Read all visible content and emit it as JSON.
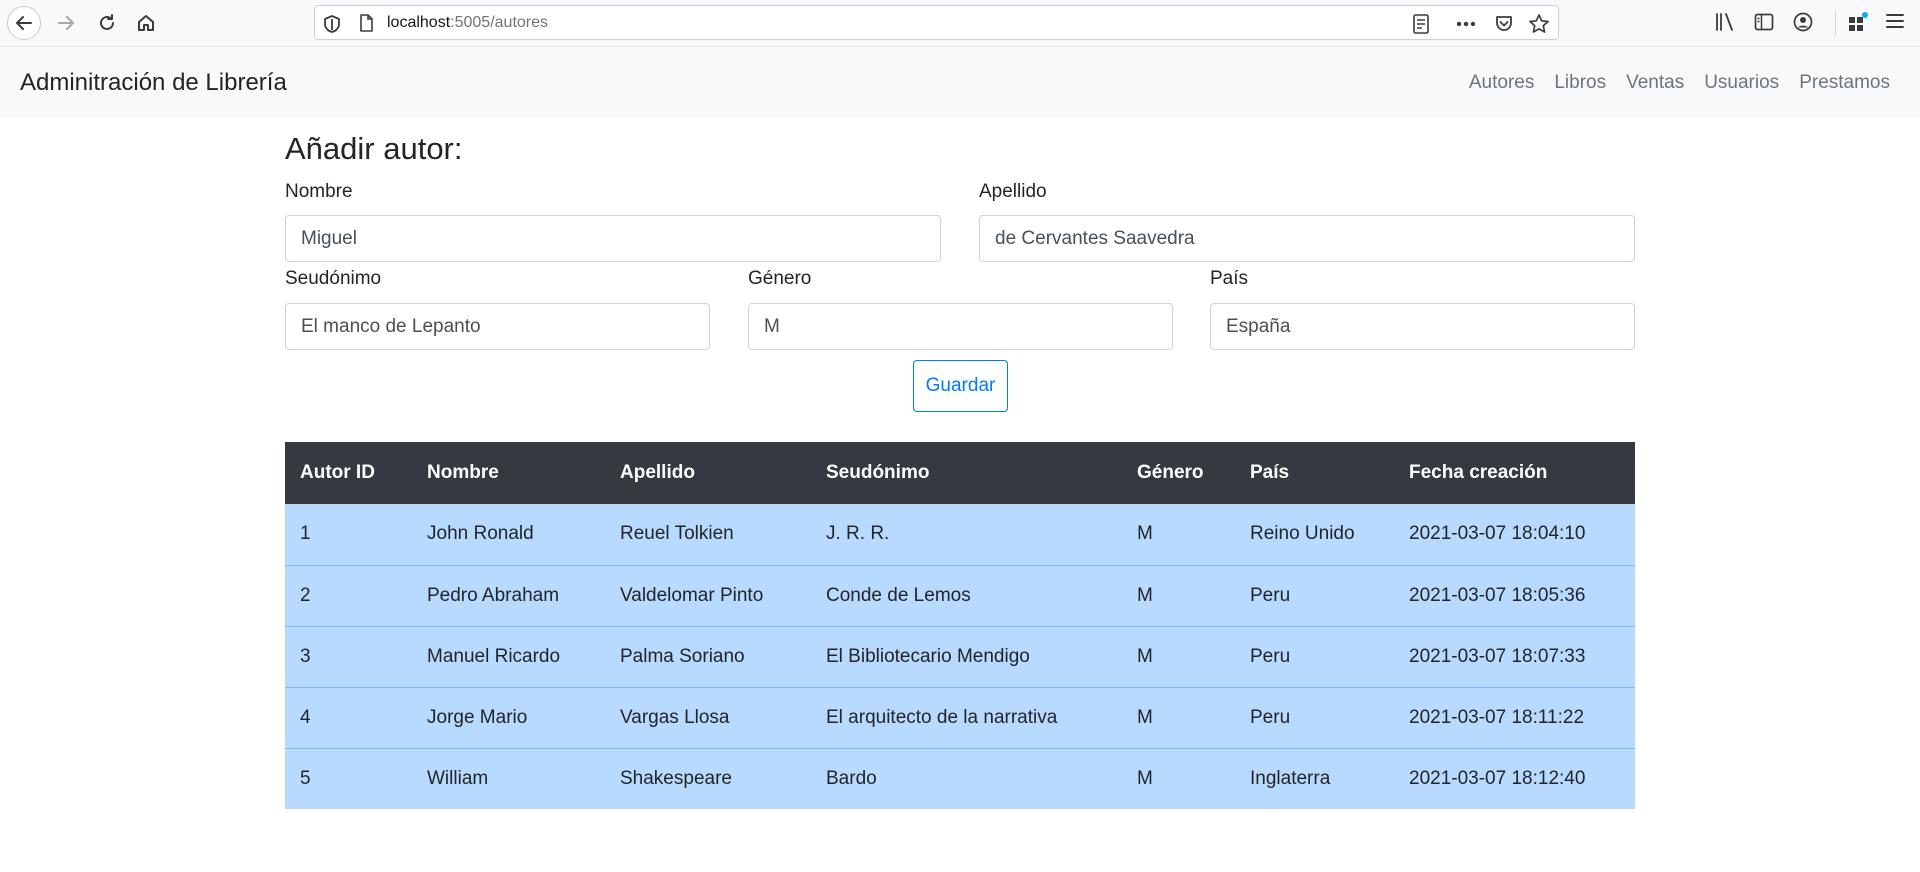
{
  "browser": {
    "url_host": "localhost",
    "url_path": ":5005/autores"
  },
  "navbar": {
    "brand": "Adminitración de Librería",
    "links": [
      {
        "label": "Autores"
      },
      {
        "label": "Libros"
      },
      {
        "label": "Ventas"
      },
      {
        "label": "Usuarios"
      },
      {
        "label": "Prestamos"
      }
    ]
  },
  "form": {
    "title": "Añadir autor:",
    "nombre": {
      "label": "Nombre",
      "value": "Miguel"
    },
    "apellido": {
      "label": "Apellido",
      "value": "de Cervantes Saavedra"
    },
    "seudonimo": {
      "label": "Seudónimo",
      "value": "El manco de Lepanto"
    },
    "genero": {
      "label": "Género",
      "value": "M"
    },
    "pais": {
      "label": "País",
      "value": "España"
    },
    "save_label": "Guardar"
  },
  "table": {
    "headers": [
      "Autor ID",
      "Nombre",
      "Apellido",
      "Seudónimo",
      "Género",
      "País",
      "Fecha creación"
    ],
    "rows": [
      [
        "1",
        "John Ronald",
        "Reuel Tolkien",
        "J. R. R.",
        "M",
        "Reino Unido",
        "2021-03-07 18:04:10"
      ],
      [
        "2",
        "Pedro Abraham",
        "Valdelomar Pinto",
        "Conde de Lemos",
        "M",
        "Peru",
        "2021-03-07 18:05:36"
      ],
      [
        "3",
        "Manuel Ricardo",
        "Palma Soriano",
        "El Bibliotecario Mendigo",
        "M",
        "Peru",
        "2021-03-07 18:07:33"
      ],
      [
        "4",
        "Jorge Mario",
        "Vargas Llosa",
        "El arquitecto de la narrativa",
        "M",
        "Peru",
        "2021-03-07 18:11:22"
      ],
      [
        "5",
        "William",
        "Shakespeare",
        "Bardo",
        "M",
        "Inglaterra",
        "2021-03-07 18:12:40"
      ]
    ]
  },
  "colors": {
    "table_header_bg": "#343a40",
    "table_row_bg": "#b8daff",
    "primary": "#007bff",
    "navbar_bg": "#f8f9fa"
  },
  "icons": [
    "back-arrow-icon",
    "forward-arrow-icon",
    "reload-icon",
    "home-icon",
    "shield-icon",
    "page-icon",
    "reader-view-icon",
    "more-dots-icon",
    "pocket-icon",
    "bookmark-star-icon",
    "library-icon",
    "sidebar-icon",
    "account-icon",
    "extensions-icon",
    "hamburger-menu-icon"
  ]
}
